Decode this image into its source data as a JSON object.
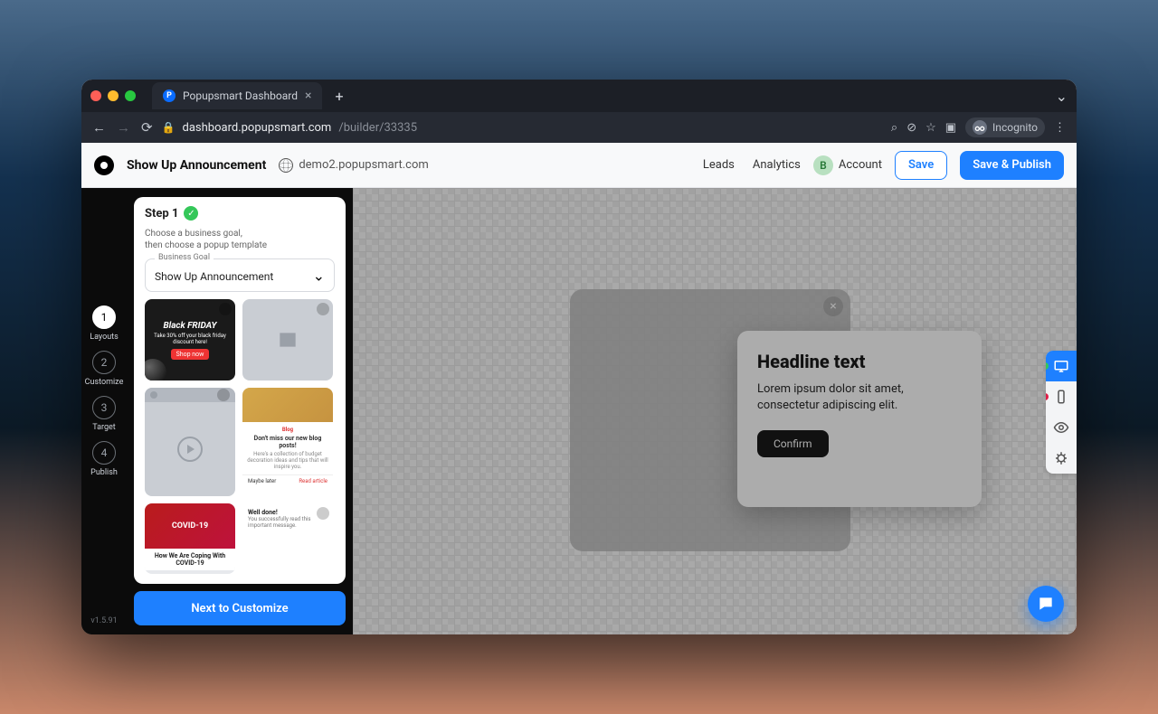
{
  "browser": {
    "tab_title": "Popupsmart Dashboard",
    "url_host": "dashboard.popupsmart.com",
    "url_path": "/builder/33335",
    "incognito_label": "Incognito"
  },
  "header": {
    "title": "Show Up Announcement",
    "site": "demo2.popupsmart.com",
    "leads": "Leads",
    "analytics": "Analytics",
    "account": "Account",
    "account_initial": "B",
    "save": "Save",
    "save_publish": "Save & Publish"
  },
  "rail": {
    "steps": [
      {
        "num": "1",
        "label": "Layouts"
      },
      {
        "num": "2",
        "label": "Customize"
      },
      {
        "num": "3",
        "label": "Target"
      },
      {
        "num": "4",
        "label": "Publish"
      }
    ],
    "version": "v1.5.91"
  },
  "panel": {
    "step_label": "Step 1",
    "hint_line1": "Choose a business goal,",
    "hint_line2": "then choose a popup template",
    "select_label": "Business Goal",
    "select_value": "Show Up Announcement",
    "templates": {
      "bf_title": "Black FRIDAY",
      "bf_sub": "Take 30% off your black friday discount here!",
      "bf_cta": "Shop now",
      "blog_cat": "Blog",
      "blog_head": "Don't miss our new blog posts!",
      "blog_body": "Here's a collection of budget decoration ideas and tips that will inspire you.",
      "blog_later": "Maybe later",
      "blog_read": "Read article",
      "covid": "COVID-19",
      "covid_caption": "How We Are Coping With COVID-19",
      "welldone_t": "Well done!",
      "welldone_b": "You successfully read this important message."
    },
    "next": "Next to Customize"
  },
  "popup": {
    "headline": "Headline text",
    "body": "Lorem ipsum dolor sit amet, consectetur adipiscing elit.",
    "confirm": "Confirm"
  }
}
